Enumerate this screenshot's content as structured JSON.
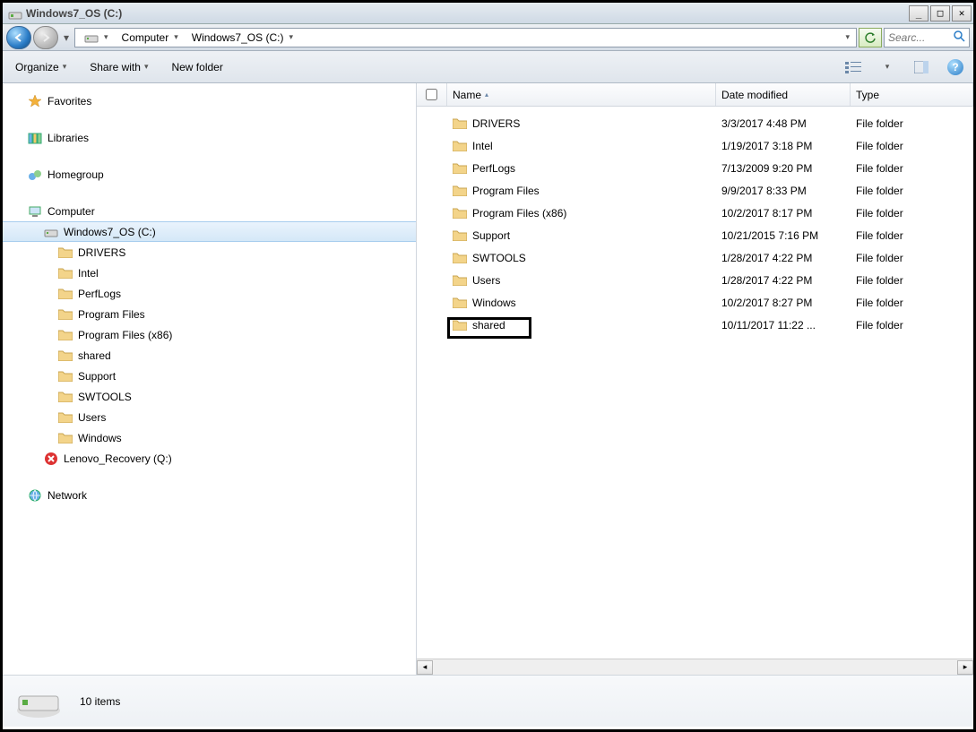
{
  "window": {
    "title": "Windows7_OS (C:)"
  },
  "breadcrumb": {
    "seg1": "Computer",
    "seg2": "Windows7_OS (C:)"
  },
  "search": {
    "placeholder": "Searc..."
  },
  "toolbar": {
    "organize": "Organize",
    "share": "Share with",
    "newfolder": "New folder"
  },
  "columns": {
    "name": "Name",
    "date": "Date modified",
    "type": "Type"
  },
  "sidebar": {
    "favorites": "Favorites",
    "libraries": "Libraries",
    "homegroup": "Homegroup",
    "computer": "Computer",
    "network": "Network",
    "drive_c": "Windows7_OS (C:)",
    "drive_q": "Lenovo_Recovery (Q:)",
    "tree": {
      "t0": "DRIVERS",
      "t1": "Intel",
      "t2": "PerfLogs",
      "t3": "Program Files",
      "t4": "Program Files (x86)",
      "t5": "shared",
      "t6": "Support",
      "t7": "SWTOOLS",
      "t8": "Users",
      "t9": "Windows"
    }
  },
  "files": [
    {
      "name": "DRIVERS",
      "date": "3/3/2017 4:48 PM",
      "type": "File folder"
    },
    {
      "name": "Intel",
      "date": "1/19/2017 3:18 PM",
      "type": "File folder"
    },
    {
      "name": "PerfLogs",
      "date": "7/13/2009 9:20 PM",
      "type": "File folder"
    },
    {
      "name": "Program Files",
      "date": "9/9/2017 8:33 PM",
      "type": "File folder"
    },
    {
      "name": "Program Files (x86)",
      "date": "10/2/2017 8:17 PM",
      "type": "File folder"
    },
    {
      "name": "Support",
      "date": "10/21/2015 7:16 PM",
      "type": "File folder"
    },
    {
      "name": "SWTOOLS",
      "date": "1/28/2017 4:22 PM",
      "type": "File folder"
    },
    {
      "name": "Users",
      "date": "1/28/2017 4:22 PM",
      "type": "File folder"
    },
    {
      "name": "Windows",
      "date": "10/2/2017 8:27 PM",
      "type": "File folder"
    },
    {
      "name": "shared",
      "date": "10/11/2017 11:22 ...",
      "type": "File folder",
      "highlighted": true
    }
  ],
  "status": {
    "count": "10 items"
  }
}
